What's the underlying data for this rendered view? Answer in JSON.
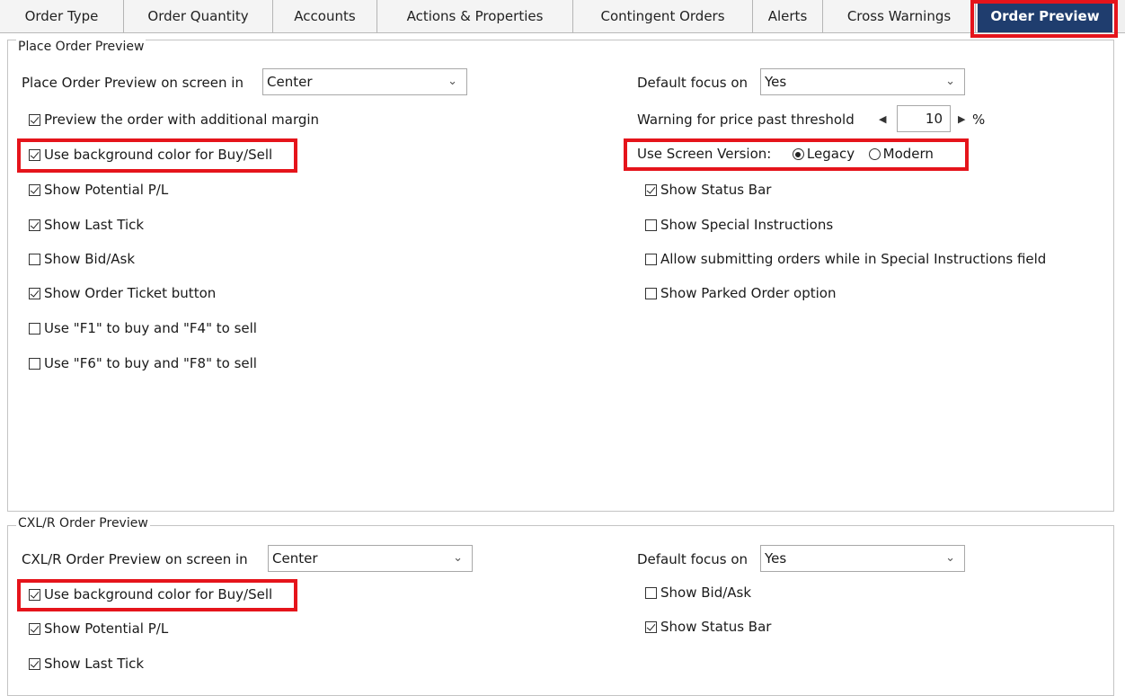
{
  "tabs": [
    {
      "label": "Order Type"
    },
    {
      "label": "Order Quantity"
    },
    {
      "label": "Accounts"
    },
    {
      "label": "Actions & Properties"
    },
    {
      "label": "Contingent Orders"
    },
    {
      "label": "Alerts"
    },
    {
      "label": "Cross Warnings"
    },
    {
      "label": "Order Preview"
    }
  ],
  "place": {
    "legend": "Place Order Preview",
    "screen_label": "Place Order Preview on screen in",
    "screen_value": "Center",
    "focus_label": "Default focus on",
    "focus_value": "Yes",
    "threshold_label": "Warning for price past threshold",
    "threshold_value": "10",
    "threshold_unit": "%",
    "version_label": "Use Screen Version:",
    "version_legacy": "Legacy",
    "version_modern": "Modern",
    "version_selected": "Legacy",
    "left_options": [
      {
        "label": "Preview the order with additional margin",
        "checked": true
      },
      {
        "label": "Use background color for Buy/Sell",
        "checked": true
      },
      {
        "label": "Show Potential P/L",
        "checked": true
      },
      {
        "label": "Show Last Tick",
        "checked": true
      },
      {
        "label": "Show Bid/Ask",
        "checked": false
      },
      {
        "label": "Show Order Ticket button",
        "checked": true
      },
      {
        "label": "Use \"F1\" to buy and \"F4\" to sell",
        "checked": false
      },
      {
        "label": "Use \"F6\" to buy and \"F8\" to sell",
        "checked": false
      }
    ],
    "right_options": [
      {
        "label": "Show Status Bar",
        "checked": true
      },
      {
        "label": "Show Special Instructions",
        "checked": false
      },
      {
        "label": "Allow submitting orders while in Special Instructions field",
        "checked": false
      },
      {
        "label": "Show Parked Order option",
        "checked": false
      }
    ]
  },
  "cxl": {
    "legend": "CXL/R Order Preview",
    "screen_label": "CXL/R Order Preview on screen in",
    "screen_value": "Center",
    "focus_label": "Default focus on",
    "focus_value": "Yes",
    "left_options": [
      {
        "label": "Use background color for Buy/Sell",
        "checked": true
      },
      {
        "label": "Show Potential P/L",
        "checked": true
      },
      {
        "label": "Show Last Tick",
        "checked": true
      }
    ],
    "right_options": [
      {
        "label": "Show Bid/Ask",
        "checked": false
      },
      {
        "label": "Show Status Bar",
        "checked": true
      }
    ]
  },
  "colors": {
    "active_tab": "#1f3d6e",
    "highlight": "#e5141b"
  },
  "icons": {
    "dropdown": "chevron-down-icon",
    "left": "arrow-left-icon",
    "right": "arrow-right-icon"
  }
}
